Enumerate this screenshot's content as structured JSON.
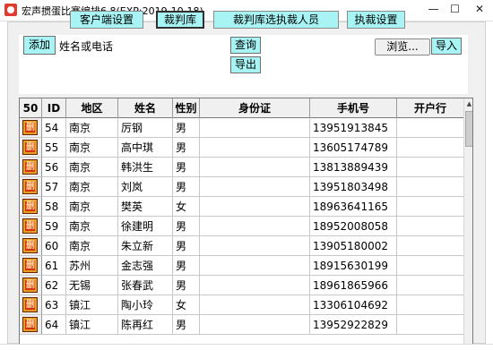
{
  "window": {
    "title": "宏声掼蛋比赛编排6.8(EXP:2019-10-18)",
    "minimize": "—",
    "maximize": "☐",
    "close": "✕"
  },
  "tabs": [
    {
      "label": "客户端设置",
      "selected": false
    },
    {
      "label": "裁判库",
      "selected": true
    },
    {
      "label": "裁判库选执裁人员",
      "selected": false
    },
    {
      "label": "执裁设置",
      "selected": false
    }
  ],
  "form": {
    "add_label": "添加",
    "search_placeholder": "姓名或电话",
    "search_value": "",
    "query_label": "查询",
    "export_label": "导出",
    "browse_label": "浏览...",
    "import_label": "导入"
  },
  "table": {
    "columns": [
      "50",
      "ID",
      "地区",
      "姓名",
      "性别",
      "身份证",
      "手机号",
      "开户行"
    ],
    "delete_glyph": "删",
    "rows": [
      {
        "id": "54",
        "region": "南京",
        "name": "厉钢",
        "gender": "男",
        "idcard": "",
        "phone": "13951913845",
        "bank": ""
      },
      {
        "id": "55",
        "region": "南京",
        "name": "高中琪",
        "gender": "男",
        "idcard": "",
        "phone": "13605174789",
        "bank": ""
      },
      {
        "id": "56",
        "region": "南京",
        "name": "韩洪生",
        "gender": "男",
        "idcard": "",
        "phone": "13813889439",
        "bank": ""
      },
      {
        "id": "57",
        "region": "南京",
        "name": "刘岚",
        "gender": "男",
        "idcard": "",
        "phone": "13951803498",
        "bank": ""
      },
      {
        "id": "58",
        "region": "南京",
        "name": "樊英",
        "gender": "女",
        "idcard": "",
        "phone": "18963641165",
        "bank": ""
      },
      {
        "id": "59",
        "region": "南京",
        "name": "徐建明",
        "gender": "男",
        "idcard": "",
        "phone": "18952008058",
        "bank": ""
      },
      {
        "id": "60",
        "region": "南京",
        "name": "朱立新",
        "gender": "男",
        "idcard": "",
        "phone": "13905180002",
        "bank": ""
      },
      {
        "id": "61",
        "region": "苏州",
        "name": "金志强",
        "gender": "男",
        "idcard": "",
        "phone": "18915630199",
        "bank": ""
      },
      {
        "id": "62",
        "region": "无锡",
        "name": "张春武",
        "gender": "男",
        "idcard": "",
        "phone": "18961865966",
        "bank": ""
      },
      {
        "id": "63",
        "region": "镇江",
        "name": "陶小玲",
        "gender": "女",
        "idcard": "",
        "phone": "13306104692",
        "bank": ""
      },
      {
        "id": "64",
        "region": "镇江",
        "name": "陈再红",
        "gender": "男",
        "idcard": "",
        "phone": "13952922829",
        "bank": ""
      }
    ]
  },
  "colors": {
    "button_cyan": "#a8f4f4",
    "delete_red": "#d63010",
    "delete_frame": "#e0a020"
  }
}
